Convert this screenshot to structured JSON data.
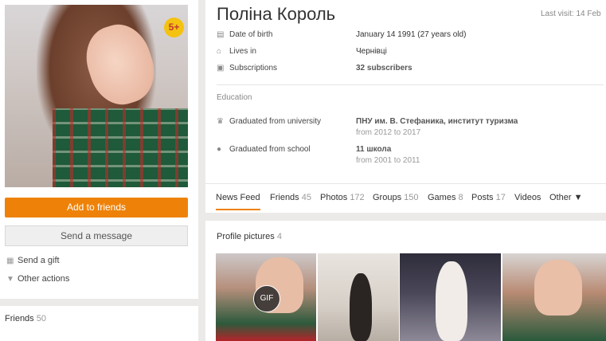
{
  "profile": {
    "name": "Поліна Король",
    "last_visit": "Last visit: 14 Feb",
    "badge": "5+",
    "add_friend_label": "Add to friends",
    "send_message_label": "Send a message",
    "send_gift_label": "Send a gift",
    "other_actions_label": "Other actions"
  },
  "friends_panel": {
    "label": "Friends",
    "count": "50"
  },
  "info": {
    "dob_label": "Date of birth",
    "dob_value": "January 14 1991 (27 years old)",
    "lives_label": "Lives in",
    "lives_value": "Чернівці",
    "subs_label": "Subscriptions",
    "subs_value": "32 subscribers"
  },
  "education": {
    "section_label": "Education",
    "university_label": "Graduated from university",
    "university_value": "ПНУ им. В. Стефаника, институт туризма",
    "university_years": "from 2012 to 2017",
    "school_label": "Graduated from school",
    "school_value": "11 школа",
    "school_years": "from 2001 to 2011"
  },
  "tabs": [
    {
      "label": "News Feed",
      "count": ""
    },
    {
      "label": "Friends",
      "count": "45"
    },
    {
      "label": "Photos",
      "count": "172"
    },
    {
      "label": "Groups",
      "count": "150"
    },
    {
      "label": "Games",
      "count": "8"
    },
    {
      "label": "Posts",
      "count": "17"
    },
    {
      "label": "Videos",
      "count": ""
    },
    {
      "label": "Other ▼",
      "count": ""
    }
  ],
  "profile_pictures": {
    "title": "Profile pictures",
    "count": "4",
    "gif_label": "GIF"
  },
  "colors": {
    "accent": "#ee8208",
    "badge": "#f4c211"
  }
}
